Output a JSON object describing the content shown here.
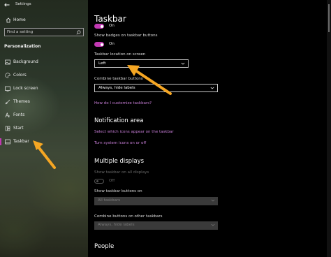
{
  "window": {
    "title": "Settings"
  },
  "nav": {
    "back_icon": "back-arrow-icon",
    "home": {
      "label": "Home",
      "icon": "home-icon"
    },
    "search": {
      "placeholder": "Find a setting",
      "icon": "search-icon"
    },
    "section_label": "Personalization",
    "items": [
      {
        "label": "Background",
        "icon": "picture-icon"
      },
      {
        "label": "Colors",
        "icon": "palette-icon"
      },
      {
        "label": "Lock screen",
        "icon": "lock-screen-icon"
      },
      {
        "label": "Themes",
        "icon": "brush-icon"
      },
      {
        "label": "Fonts",
        "icon": "font-icon"
      },
      {
        "label": "Start",
        "icon": "start-icon"
      },
      {
        "label": "Taskbar",
        "icon": "taskbar-icon",
        "active": true
      }
    ]
  },
  "content": {
    "title": "Taskbar",
    "top_toggle": {
      "state_text": "On",
      "on": true
    },
    "badges": {
      "label": "Show badges on taskbar buttons",
      "state_text": "On",
      "on": true
    },
    "location": {
      "label": "Taskbar location on screen",
      "value": "Left"
    },
    "combine": {
      "label": "Combine taskbar buttons",
      "value": "Always, hide labels"
    },
    "customize_link": "How do I customize taskbars?",
    "notification": {
      "heading": "Notification area",
      "link1": "Select which icons appear on the taskbar",
      "link2": "Turn system icons on or off"
    },
    "multiple": {
      "heading": "Multiple displays",
      "show_all_label": "Show taskbar on all displays",
      "show_all_state_text": "Off",
      "show_buttons_label": "Show taskbar buttons on",
      "show_buttons_value": "All taskbars",
      "combine_other_label": "Combine buttons on other taskbars",
      "combine_other_value": "Always, hide labels"
    },
    "people": {
      "heading": "People"
    }
  },
  "colors": {
    "accent": "#c239b3",
    "link": "#c87ed8",
    "annotation_arrow": "#f5a623"
  }
}
